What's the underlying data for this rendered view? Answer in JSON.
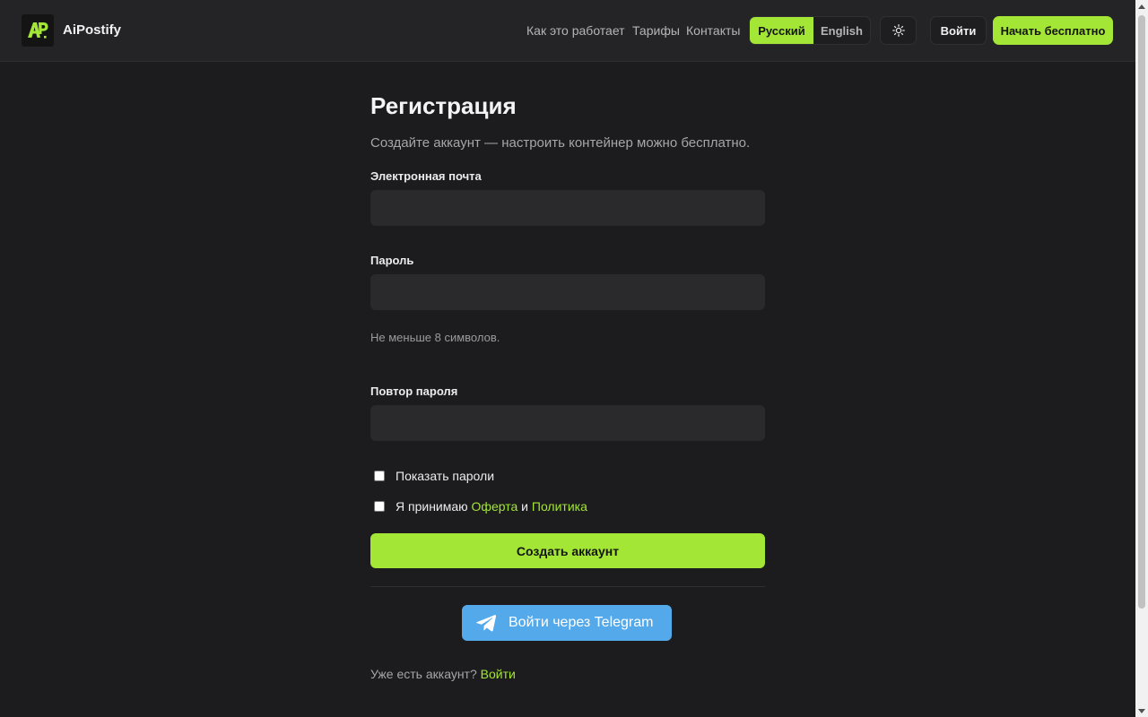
{
  "header": {
    "brand": "AiPostify",
    "logo_text": "AP",
    "nav": [
      "Как это работает",
      "Тарифы",
      "Контакты"
    ],
    "languages": {
      "ru": "Русский",
      "en": "English",
      "selected": "ru"
    },
    "theme_icon": "sun-icon",
    "login": "Войти",
    "start": "Начать бесплатно"
  },
  "form": {
    "title": "Регистрация",
    "subtitle": "Создайте аккаунт — настроить контейнер можно бесплатно.",
    "email_label": "Электронная почта",
    "email_value": "",
    "password_label": "Пароль",
    "password_value": "",
    "password_hint": "Не меньше 8 символов.",
    "repeat_label": "Повтор пароля",
    "repeat_value": "",
    "show_passwords": "Показать пароли",
    "accept_prefix": "Я принимаю",
    "offer_link": "Оферта",
    "and": "и",
    "policy_link": "Политика",
    "submit": "Создать аккаунт",
    "telegram": "Войти через Telegram",
    "have_account": "Уже есть аккаунт?",
    "login_link": "Войти"
  },
  "colors": {
    "accent": "#a3e635",
    "background": "#1c1c1e",
    "header": "#242426",
    "input": "#2a2a2d",
    "telegram": "#54a9eb"
  }
}
